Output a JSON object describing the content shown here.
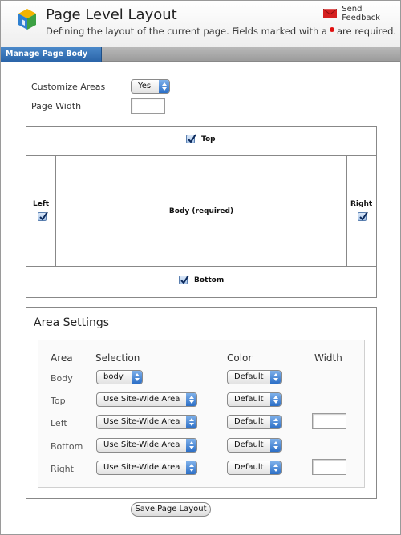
{
  "header": {
    "title": "Page Level Layout",
    "subtitle_before": "Defining the layout of the current page. Fields marked with a",
    "subtitle_after": "are required.",
    "feedback_label": "Send Feedback",
    "icons": {
      "logo": "cms-cube-logo-icon",
      "feedback": "mail-envelope-icon"
    },
    "colors": {
      "required_dot": "#e01010",
      "tab_active": "#3474b8"
    }
  },
  "tabs": [
    {
      "label": "Manage Page Body Areas",
      "active": true
    }
  ],
  "form": {
    "customize_label": "Customize Areas",
    "customize_value": "Yes",
    "page_width_label": "Page Width",
    "page_width_value": ""
  },
  "layout": {
    "top": {
      "label": "Top",
      "checked": true
    },
    "left": {
      "label": "Left",
      "checked": true
    },
    "body": {
      "label": "Body (required)"
    },
    "right": {
      "label": "Right",
      "checked": true
    },
    "bottom": {
      "label": "Bottom",
      "checked": true
    }
  },
  "settings": {
    "title": "Area Settings",
    "headers": {
      "area": "Area",
      "selection": "Selection",
      "color": "Color",
      "width": "Width"
    },
    "rows": [
      {
        "area": "Body",
        "selection": "body",
        "color": "Default"
      },
      {
        "area": "Top",
        "selection": "Use Site-Wide Area",
        "color": "Default"
      },
      {
        "area": "Left",
        "selection": "Use Site-Wide Area",
        "color": "Default",
        "width": ""
      },
      {
        "area": "Bottom",
        "selection": "Use Site-Wide Area",
        "color": "Default"
      },
      {
        "area": "Right",
        "selection": "Use Site-Wide Area",
        "color": "Default",
        "width": ""
      }
    ]
  },
  "save_label": "Save Page Layout"
}
